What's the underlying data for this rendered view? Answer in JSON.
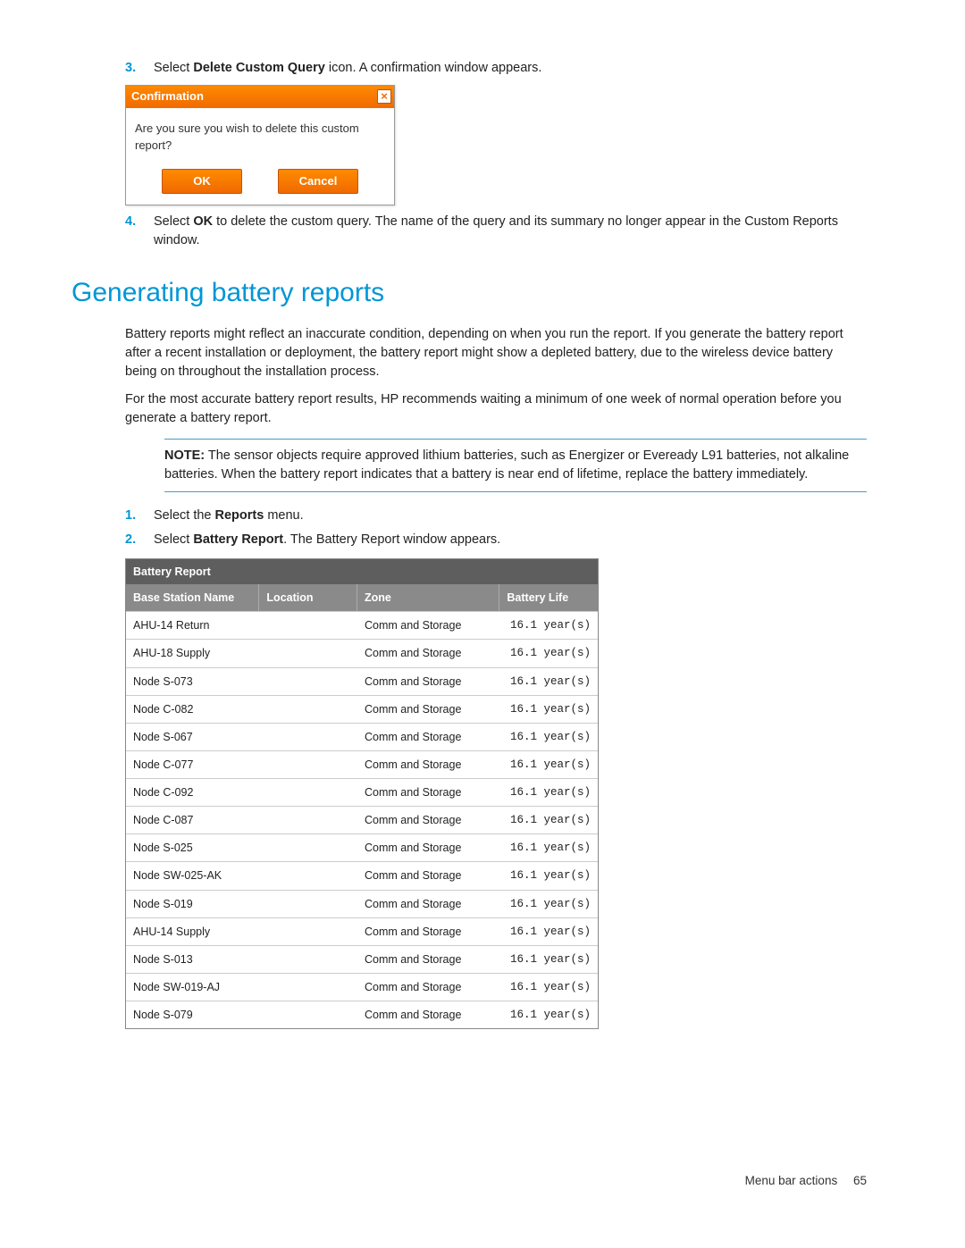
{
  "steps_upper": {
    "s3": {
      "num": "3.",
      "pre": "Select ",
      "bold": "Delete Custom Query",
      "post": " icon. A confirmation window appears."
    },
    "s4": {
      "num": "4.",
      "pre": "Select ",
      "bold": "OK",
      "post": " to delete the custom query. The name of the query and its summary no longer appear in the Custom Reports window."
    }
  },
  "confirmation": {
    "title": "Confirmation",
    "close": "×",
    "message": "Are you sure you wish to delete this custom report?",
    "ok": "OK",
    "cancel": "Cancel"
  },
  "section_heading": "Generating battery reports",
  "para1": "Battery reports might reflect an inaccurate condition, depending on when you run the report. If you generate the battery report after a recent installation or deployment, the battery report might show a depleted battery, due to the wireless device battery being on throughout the installation process.",
  "para2": "For the most accurate battery report results, HP recommends waiting a minimum of one week of normal operation before you generate a battery report.",
  "note": {
    "label": "NOTE:",
    "text": " The sensor objects require approved lithium batteries, such as Energizer or Eveready L91 batteries, not alkaline batteries. When the battery report indicates that a battery is near end of lifetime, replace the battery immediately."
  },
  "steps_lower": {
    "s1": {
      "num": "1.",
      "pre": "Select the ",
      "bold": "Reports",
      "post": " menu."
    },
    "s2": {
      "num": "2.",
      "pre": "Select ",
      "bold": "Battery Report",
      "post": ". The Battery Report window appears."
    }
  },
  "report": {
    "title": "Battery Report",
    "headers": {
      "name": "Base Station Name",
      "location": "Location",
      "zone": "Zone",
      "life": "Battery Life"
    },
    "rows": [
      {
        "name": "AHU-14 Return",
        "location": "",
        "zone": "Comm and Storage",
        "life": "16.1 year(s)"
      },
      {
        "name": "AHU-18 Supply",
        "location": "",
        "zone": "Comm and Storage",
        "life": "16.1 year(s)"
      },
      {
        "name": "Node S-073",
        "location": "",
        "zone": "Comm and Storage",
        "life": "16.1 year(s)"
      },
      {
        "name": "Node C-082",
        "location": "",
        "zone": "Comm and Storage",
        "life": "16.1 year(s)"
      },
      {
        "name": "Node S-067",
        "location": "",
        "zone": "Comm and Storage",
        "life": "16.1 year(s)"
      },
      {
        "name": "Node C-077",
        "location": "",
        "zone": "Comm and Storage",
        "life": "16.1 year(s)"
      },
      {
        "name": "Node C-092",
        "location": "",
        "zone": "Comm and Storage",
        "life": "16.1 year(s)"
      },
      {
        "name": "Node C-087",
        "location": "",
        "zone": "Comm and Storage",
        "life": "16.1 year(s)"
      },
      {
        "name": "Node S-025",
        "location": "",
        "zone": "Comm and Storage",
        "life": "16.1 year(s)"
      },
      {
        "name": "Node SW-025-AK",
        "location": "",
        "zone": "Comm and Storage",
        "life": "16.1 year(s)"
      },
      {
        "name": "Node S-019",
        "location": "",
        "zone": "Comm and Storage",
        "life": "16.1 year(s)"
      },
      {
        "name": "AHU-14 Supply",
        "location": "",
        "zone": "Comm and Storage",
        "life": "16.1 year(s)"
      },
      {
        "name": "Node S-013",
        "location": "",
        "zone": "Comm and Storage",
        "life": "16.1 year(s)"
      },
      {
        "name": "Node SW-019-AJ",
        "location": "",
        "zone": "Comm and Storage",
        "life": "16.1 year(s)"
      },
      {
        "name": "Node S-079",
        "location": "",
        "zone": "Comm and Storage",
        "life": "16.1 year(s)"
      }
    ]
  },
  "footer": {
    "section": "Menu bar actions",
    "page": "65"
  }
}
